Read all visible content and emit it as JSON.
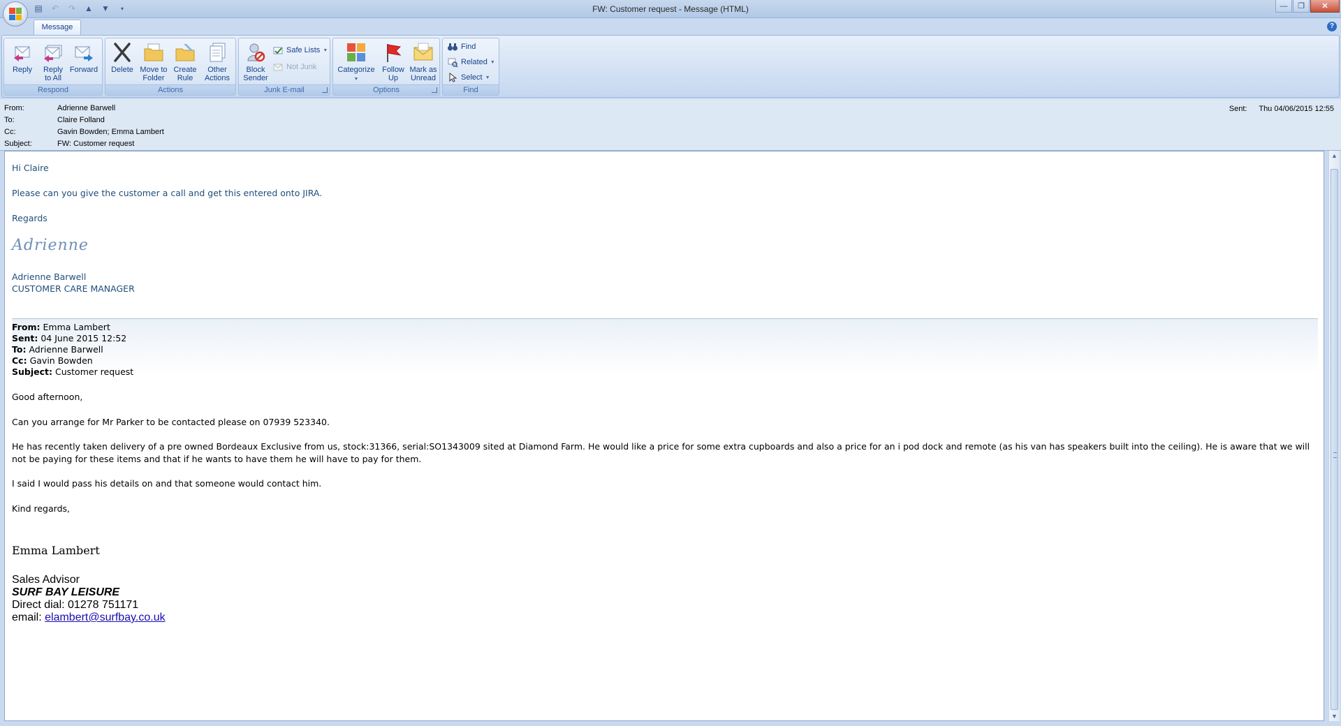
{
  "window": {
    "title": "FW: Customer request - Message (HTML)",
    "controls": [
      "minimize-icon",
      "restore-icon",
      "close-icon"
    ]
  },
  "quick_access": [
    "save-icon",
    "undo-icon",
    "redo-icon",
    "previous-icon",
    "next-icon",
    "customize-icon"
  ],
  "tabs": [
    {
      "label": "Message"
    }
  ],
  "ribbon": {
    "respond": {
      "label": "Respond",
      "reply": "Reply",
      "reply_all": "Reply\nto All",
      "forward": "Forward"
    },
    "actions": {
      "label": "Actions",
      "delete": "Delete",
      "move": "Move to\nFolder",
      "create_rule": "Create\nRule",
      "other": "Other\nActions"
    },
    "junk": {
      "label": "Junk E-mail",
      "block": "Block\nSender",
      "safe_lists": "Safe Lists",
      "not_junk": "Not Junk"
    },
    "options": {
      "label": "Options",
      "categorize": "Categorize",
      "follow_up": "Follow\nUp",
      "mark_unread": "Mark as\nUnread"
    },
    "find": {
      "label": "Find",
      "find": "Find",
      "related": "Related",
      "select": "Select"
    }
  },
  "header": {
    "from_label": "From:",
    "from": "Adrienne Barwell",
    "to_label": "To:",
    "to": "Claire Folland",
    "cc_label": "Cc:",
    "cc": "Gavin Bowden; Emma Lambert",
    "subject_label": "Subject:",
    "subject": "FW: Customer request",
    "sent_label": "Sent:",
    "sent": "Thu 04/06/2015 12:55"
  },
  "body": {
    "greeting": "Hi Claire",
    "line1": "Please can you give the customer a call and get this entered onto JIRA.",
    "regards": "Regards",
    "signature_script": "Adrienne",
    "sig_name": "Adrienne Barwell",
    "sig_title": "CUSTOMER CARE MANAGER",
    "forwarded": {
      "from_label": "From:",
      "from": "Emma Lambert",
      "sent_label": "Sent:",
      "sent": "04 June 2015 12:52",
      "to_label": "To:",
      "to": "Adrienne Barwell",
      "cc_label": "Cc:",
      "cc": "Gavin Bowden",
      "subject_label": "Subject:",
      "subject": "Customer request"
    },
    "fw_greeting": "Good afternoon,",
    "fw_line1": "Can you arrange for Mr Parker to be contacted please on 07939 523340.",
    "fw_line2": "He has recently taken delivery of a pre owned Bordeaux Exclusive from us, stock:31366, serial:SO1343009 sited at Diamond Farm. He would like a price for some extra cupboards and also a price for an i pod dock and remote (as his van has speakers built into the ceiling). He is aware that we will not be paying for these items and that if he wants to have them he will have to pay for them.",
    "fw_line3": "I said I would pass his details on and that someone would contact him.",
    "fw_closing": "Kind regards,",
    "fw_name": "Emma Lambert",
    "fw_title": "Sales Advisor",
    "fw_company": "SURF BAY LEISURE",
    "fw_direct": "Direct dial: 01278 751171",
    "fw_email_label": "email: ",
    "fw_email": "elambert@surfbay.co.uk"
  }
}
